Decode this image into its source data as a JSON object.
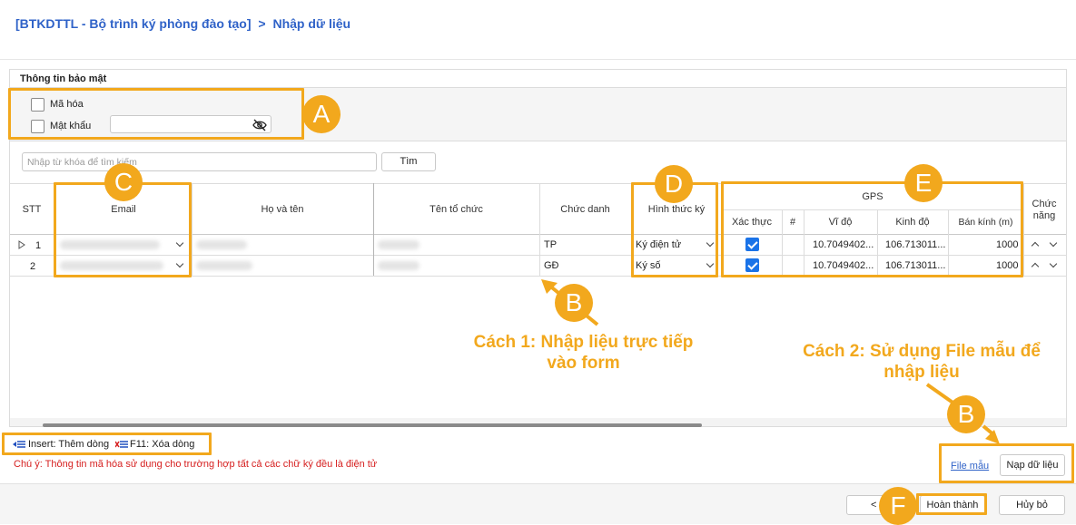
{
  "breadcrumb": {
    "root": "[BTKDTTL - Bộ trình ký phòng đào tạo]",
    "separator": ">",
    "current": "Nhập dữ liệu"
  },
  "security": {
    "title": "Thông tin bảo mật",
    "encrypt_label": "Mã hóa",
    "password_label": "Mật khẩu",
    "password_value": ""
  },
  "search": {
    "placeholder": "Nhập từ khóa để tìm kiếm",
    "button": "Tìm"
  },
  "table": {
    "headers": {
      "stt": "STT",
      "email": "Email",
      "name": "Họ và tên",
      "org": "Tên tổ chức",
      "title": "Chức danh",
      "sign_method": "Hình thức ký",
      "gps": "GPS",
      "verify": "Xác thực",
      "hash": "#",
      "lat": "Vĩ độ",
      "lng": "Kinh độ",
      "radius": "Bán kính (m)",
      "actions": "Chức năng"
    },
    "rows": [
      {
        "stt": "1",
        "title": "TP",
        "sign_method": "Ký điện tử",
        "verified": true,
        "lat": "10.7049402...",
        "lng": "106.713011...",
        "radius": "1000"
      },
      {
        "stt": "2",
        "title": "GĐ",
        "sign_method": "Ký số",
        "verified": true,
        "lat": "10.7049402...",
        "lng": "106.713011...",
        "radius": "1000"
      }
    ]
  },
  "shortcuts": {
    "insert": "Insert: Thêm dòng",
    "delete": "F11: Xóa dòng"
  },
  "note": "Chú ý: Thông tin mã hóa sử dụng cho trường hợp tất cả các chữ ký đều là điện tử",
  "file_actions": {
    "template_link": "File mẫu",
    "load_button": "Nạp dữ liệu"
  },
  "footer": {
    "back_button": "< Trở",
    "finish_button": "Hoàn thành",
    "cancel_button": "Hủy bỏ"
  },
  "annotations": {
    "A": "A",
    "B": "B",
    "C": "C",
    "D": "D",
    "E": "E",
    "F": "F",
    "method1_line1": "Cách 1: Nhập liệu trực tiếp",
    "method1_line2": "vào form",
    "method2_line1": "Cách 2: Sử dụng File mẫu để",
    "method2_line2": "nhập liệu"
  },
  "colors": {
    "accent": "#f2a81d",
    "link": "#2f62c8",
    "note_red": "#d62020",
    "checkbox_blue": "#1a73e8"
  }
}
